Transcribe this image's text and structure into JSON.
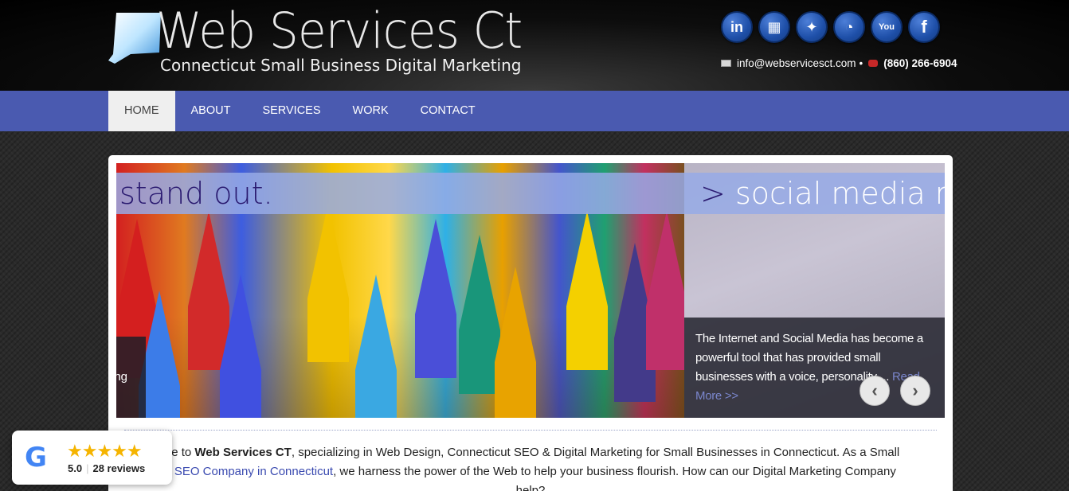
{
  "header": {
    "title": "Web Services Ct",
    "subtitle": "Connecticut Small Business Digital Marketing",
    "social": [
      {
        "name": "linkedin",
        "glyph": "in"
      },
      {
        "name": "google-my-business",
        "glyph": "▦"
      },
      {
        "name": "twitter",
        "glyph": "✦"
      },
      {
        "name": "rss",
        "glyph": "◔"
      },
      {
        "name": "youtube",
        "glyph": "You"
      },
      {
        "name": "facebook",
        "glyph": "f"
      }
    ],
    "email": "info@webservicesct.com",
    "bullet": "•",
    "phone": "(860) 266-6904"
  },
  "nav": {
    "items": [
      "HOME",
      "ABOUT",
      "SERVICES",
      "WORK",
      "CONTACT"
    ],
    "active": "HOME"
  },
  "slider": {
    "caption_left": "stand out.",
    "caption_right_prefix": ">",
    "caption_right": "social media ma",
    "left_desc": "ing",
    "right_desc": "The Internet and Social Media has become a powerful tool that has provided small businesses with a voice, personality ... ",
    "read_more": "Read More >>",
    "prev_icon": "chevron-left-icon",
    "next_icon": "chevron-right-icon"
  },
  "intro": {
    "p1": "me to ",
    "brand": "Web Services CT",
    "p2": ", specializing in Web Design, Connecticut SEO & Digital Marketing for Small Businesses in Connecticut.  As a Small",
    "p3": "s ",
    "link": "SEO Company in Connecticut",
    "p4": ", we harness the power of the Web to help your business flourish.  How can our Digital Marketing Company",
    "p5": "help?"
  },
  "google_badge": {
    "logo": "G",
    "stars": "★★★★★",
    "rating": "5.0",
    "reviews": "28 reviews"
  },
  "colors": {
    "nav_bg": "#4a5ab0",
    "link": "#3a4ab0",
    "social_blue": "#1e4fa8",
    "star": "#f5b400"
  }
}
